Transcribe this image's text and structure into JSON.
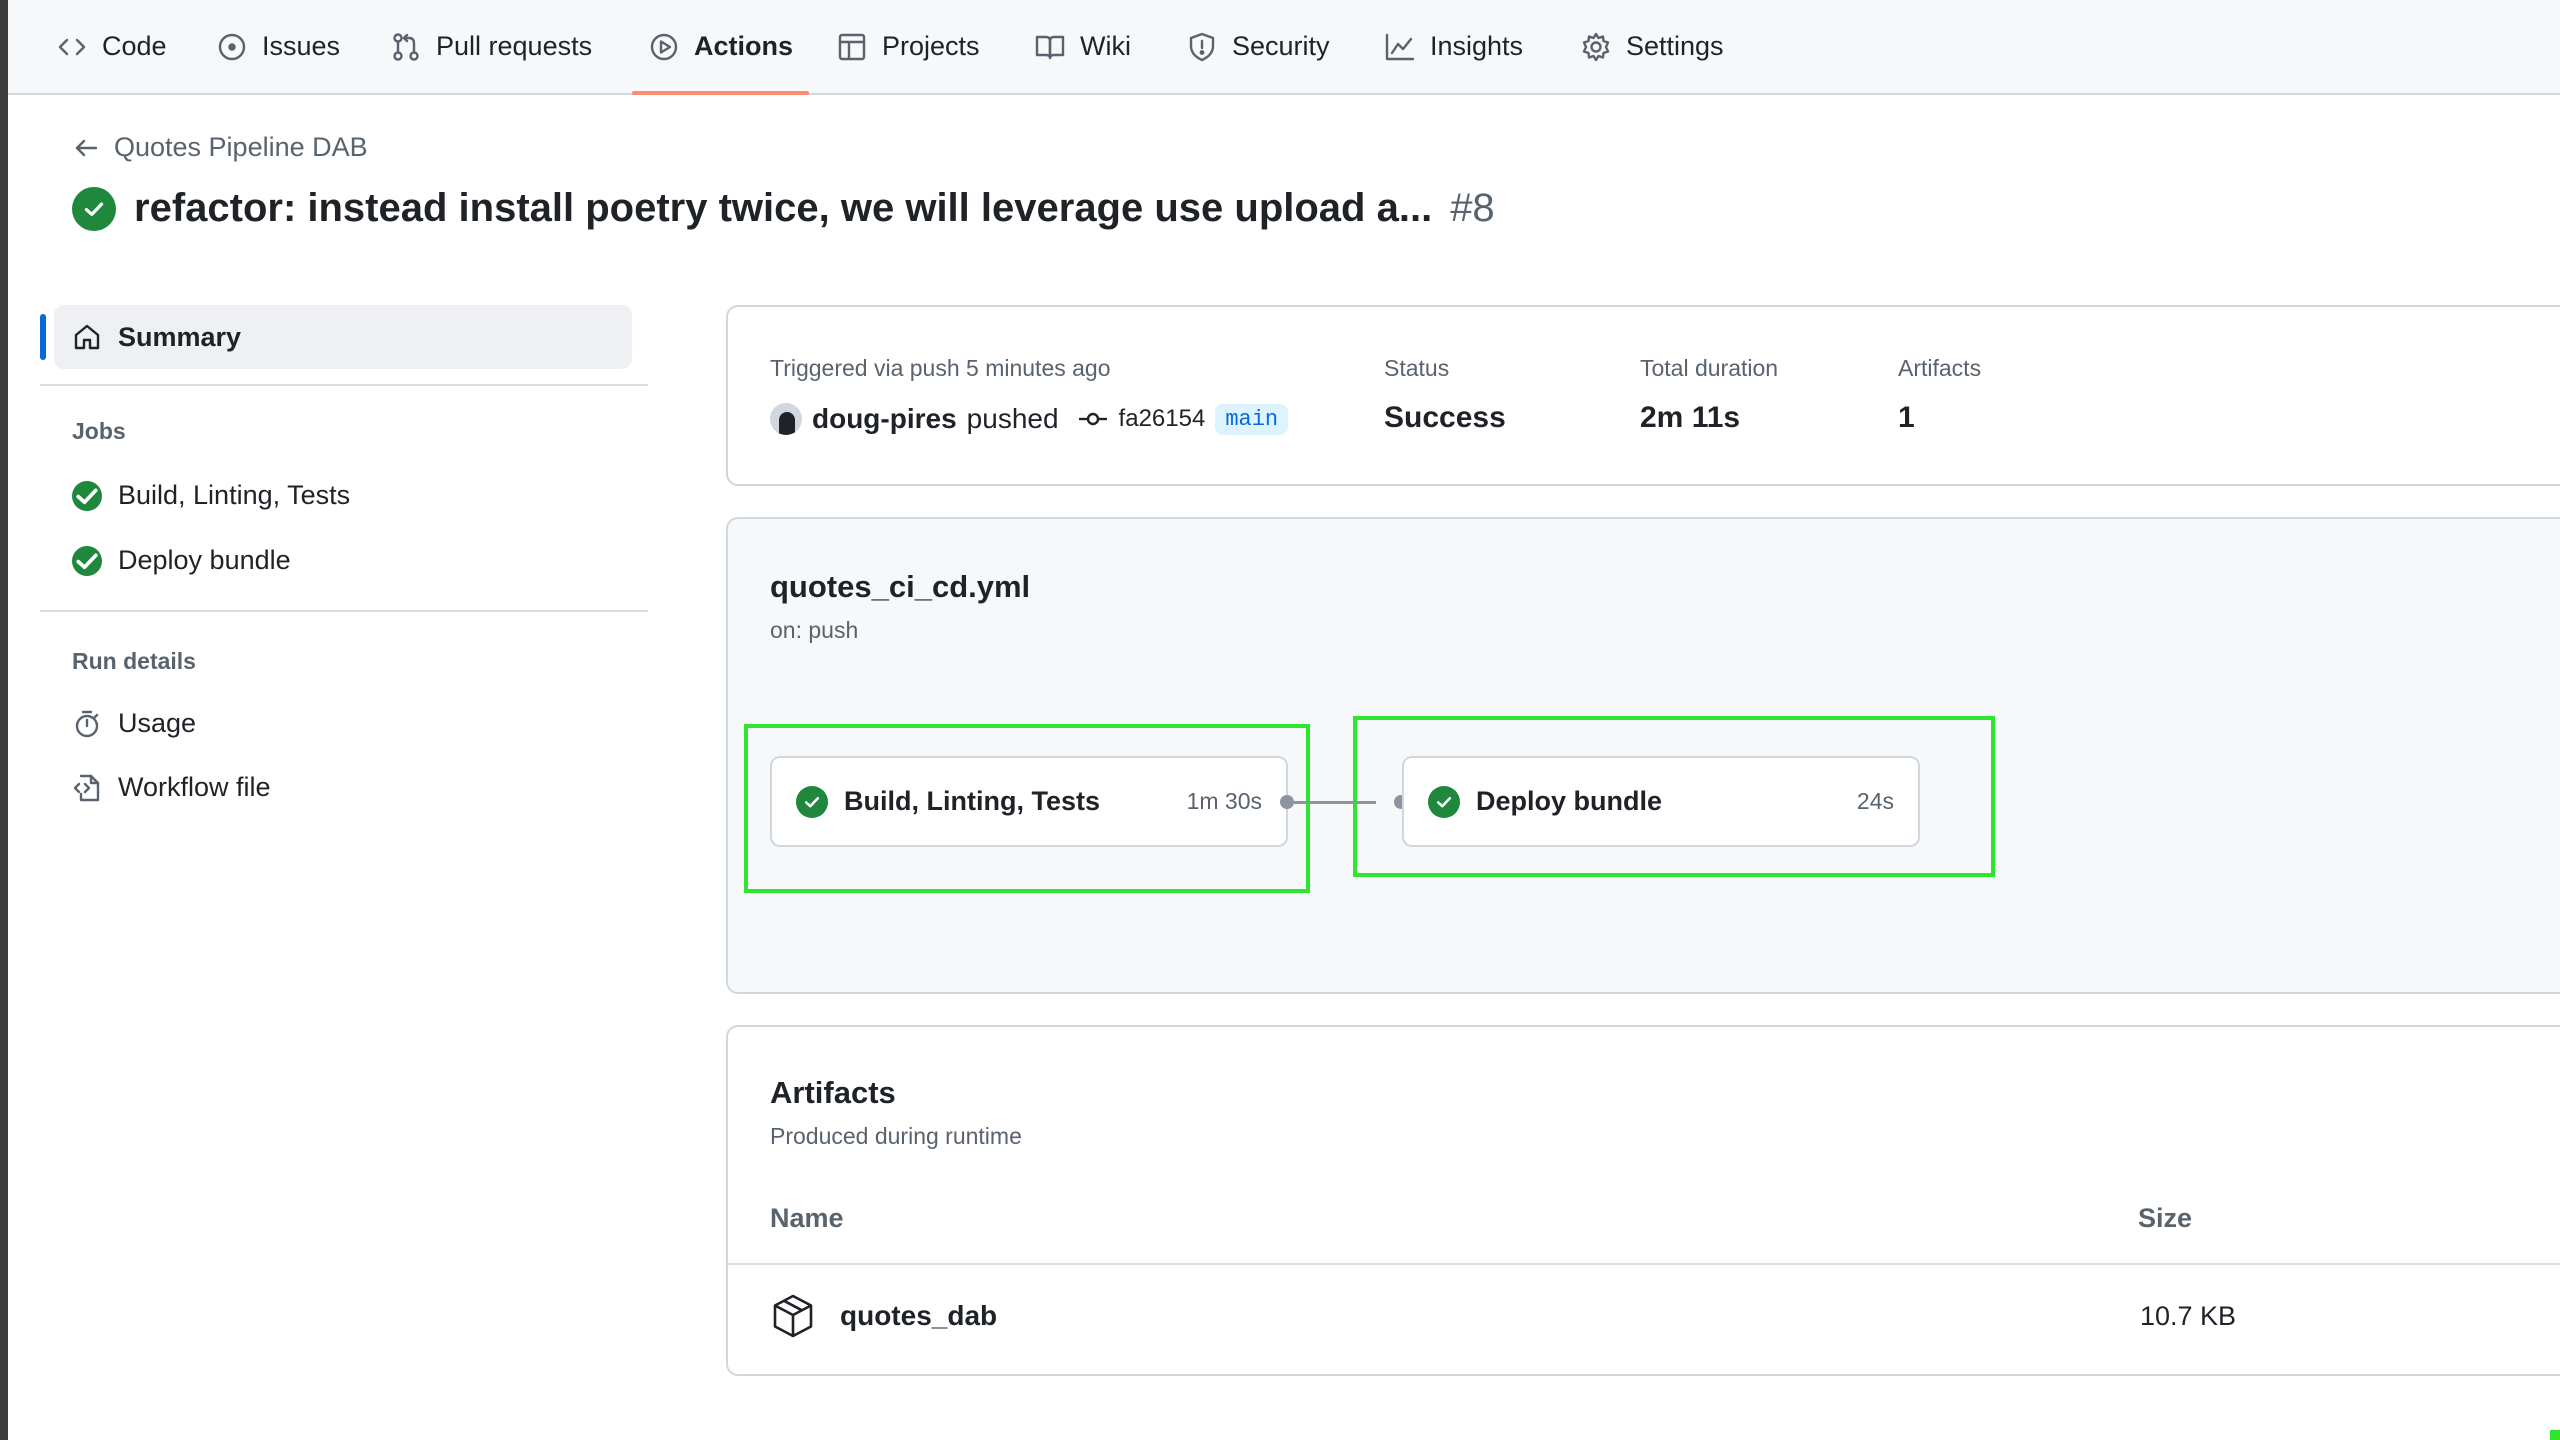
{
  "nav": {
    "items": [
      {
        "label": "Code",
        "icon": "code-icon"
      },
      {
        "label": "Issues",
        "icon": "issue-icon"
      },
      {
        "label": "Pull requests",
        "icon": "pull-request-icon"
      },
      {
        "label": "Actions",
        "icon": "actions-icon",
        "active": true
      },
      {
        "label": "Projects",
        "icon": "projects-icon"
      },
      {
        "label": "Wiki",
        "icon": "book-icon"
      },
      {
        "label": "Security",
        "icon": "shield-icon"
      },
      {
        "label": "Insights",
        "icon": "graph-icon"
      },
      {
        "label": "Settings",
        "icon": "gear-icon"
      }
    ]
  },
  "header": {
    "back_label": "Quotes Pipeline DAB",
    "title": "refactor: instead install poetry twice, we will leverage use upload a...",
    "run_number": "#8"
  },
  "sidebar": {
    "summary_label": "Summary",
    "jobs_heading": "Jobs",
    "jobs": [
      "Build, Linting, Tests",
      "Deploy bundle"
    ],
    "run_details_heading": "Run details",
    "usage_label": "Usage",
    "workflow_file_label": "Workflow file"
  },
  "summary": {
    "triggered_label": "Triggered via push 5 minutes ago",
    "actor": "doug-pires",
    "action": "pushed",
    "commit": "fa26154",
    "branch": "main",
    "status_label": "Status",
    "status_value": "Success",
    "duration_label": "Total duration",
    "duration_value": "2m 11s",
    "artifacts_label": "Artifacts",
    "artifacts_value": "1"
  },
  "workflow": {
    "file": "quotes_ci_cd.yml",
    "trigger": "on: push",
    "jobs": [
      {
        "name": "Build, Linting, Tests",
        "duration": "1m 30s"
      },
      {
        "name": "Deploy bundle",
        "duration": "24s"
      }
    ]
  },
  "artifacts": {
    "title": "Artifacts",
    "subtitle": "Produced during runtime",
    "col_name": "Name",
    "col_size": "Size",
    "rows": [
      {
        "name": "quotes_dab",
        "size": "10.7 KB"
      }
    ]
  },
  "colors": {
    "success": "#1f883d",
    "accent": "#0969da",
    "active_tab_underline": "#fd8c73",
    "highlight": "#2ee62e"
  }
}
